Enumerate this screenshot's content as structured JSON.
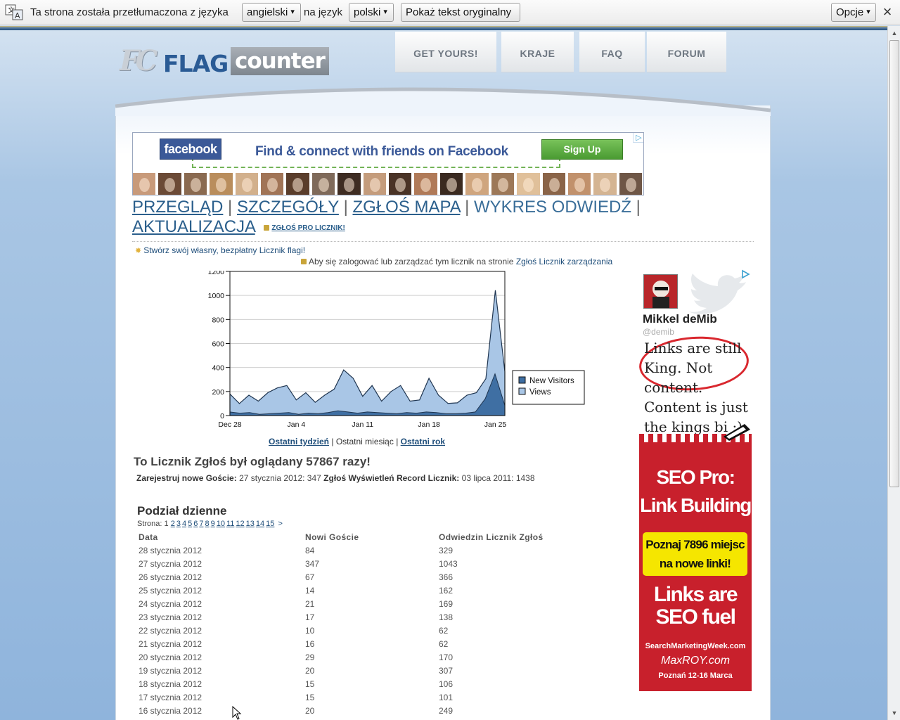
{
  "translate_bar": {
    "prefix": "Ta strona została przetłumaczona z języka",
    "from_lang": "angielski",
    "middle": "na język",
    "to_lang": "polski",
    "show_original": "Pokaż tekst oryginalny",
    "options": "Opcje"
  },
  "header": {
    "logo_flag": "FLAG",
    "logo_counter": "counter",
    "nav": [
      "GET YOURS!",
      "KRAJE",
      "FAQ",
      "FORUM"
    ]
  },
  "fb_ad": {
    "logo": "facebook",
    "tagline": "Find & connect with friends on Facebook",
    "signup": "Sign Up"
  },
  "subnav": {
    "items": [
      "PRZEGLĄD",
      "SZCZEGÓŁY",
      "ZGŁOŚ MAPA",
      "WYKRES ODWIEDŹ",
      "AKTUALIZACJA"
    ],
    "current": "WYKRES ODWIEDŹ",
    "pro": "ZGŁOŚ PRO LICZNIK!"
  },
  "create_link": "Stwórz swój własny, bezpłatny Licznik flagi!",
  "login_text": "Aby się zalogować lub zarządzać tym licznik na stronie",
  "login_link": "Zgłoś Licznik zarządzania",
  "chart_data": {
    "type": "area",
    "x_tick_labels": [
      "Dec 28",
      "Jan 4",
      "Jan 11",
      "Jan 18",
      "Jan 25"
    ],
    "y_tick_labels": [
      "0",
      "200",
      "400",
      "600",
      "800",
      "1000",
      "1200"
    ],
    "ylim": [
      0,
      1200
    ],
    "series": [
      {
        "name": "New Visitors",
        "color": "#3f6fa3",
        "values": [
          30,
          20,
          25,
          10,
          15,
          20,
          25,
          10,
          20,
          15,
          25,
          40,
          30,
          20,
          30,
          25,
          20,
          15,
          25,
          20,
          30,
          25,
          15,
          15,
          20,
          30,
          140,
          347,
          84
        ]
      },
      {
        "name": "Views",
        "color": "#a9c6e6",
        "values": [
          180,
          100,
          170,
          120,
          190,
          230,
          250,
          130,
          190,
          110,
          170,
          220,
          380,
          310,
          160,
          250,
          120,
          200,
          250,
          120,
          130,
          310,
          170,
          101,
          106,
          170,
          190,
          307,
          1043,
          366
        ]
      }
    ],
    "legend": "right"
  },
  "periods": {
    "week": "Ostatni tydzień",
    "month": "Ostatni miesiąc",
    "year": "Ostatni rok",
    "sep": "|"
  },
  "views_title": "To Licznik Zgłoś był oglądany 57867 razy!",
  "records": {
    "label1": "Zarejestruj nowe Goście:",
    "value1": "27 stycznia 2012: 347",
    "label2": "Zgłoś Wyświetleń Record Licznik:",
    "value2": "03 lipca 2011: 1438"
  },
  "daily": {
    "title": "Podział dzienne",
    "page_label": "Strona:",
    "current_page": "1",
    "pages": [
      "2",
      "3",
      "4",
      "5",
      "6",
      "7",
      "8",
      "9",
      "10",
      "11",
      "12",
      "13",
      "14",
      "15"
    ],
    "next": ">",
    "columns": [
      "Data",
      "Nowi Goście",
      "Odwiedzin Licznik Zgłoś"
    ],
    "rows": [
      [
        "28 stycznia 2012",
        "84",
        "329"
      ],
      [
        "27 stycznia 2012",
        "347",
        "1043"
      ],
      [
        "26 stycznia 2012",
        "67",
        "366"
      ],
      [
        "25 stycznia 2012",
        "14",
        "162"
      ],
      [
        "24 stycznia 2012",
        "21",
        "169"
      ],
      [
        "23 stycznia 2012",
        "17",
        "138"
      ],
      [
        "22 stycznia 2012",
        "10",
        "62"
      ],
      [
        "21 stycznia 2012",
        "16",
        "62"
      ],
      [
        "20 stycznia 2012",
        "29",
        "170"
      ],
      [
        "19 stycznia 2012",
        "20",
        "307"
      ],
      [
        "18 stycznia 2012",
        "15",
        "106"
      ],
      [
        "17 stycznia 2012",
        "15",
        "101"
      ],
      [
        "16 stycznia 2012",
        "20",
        "249"
      ]
    ]
  },
  "side_ad": {
    "name": "Mikkel deMib",
    "handle": "@demib",
    "quote": "Links are still King. Not content. Content is just the kings bi :)",
    "seo1": "SEO Pro:",
    "seo2": "Link Building",
    "yellow": "Poznaj 7896 miejsc na nowe linki!",
    "links1": "Links are",
    "links2": "SEO fuel",
    "site": "SearchMarketingWeek.com",
    "maxroy": "MaxROY.com",
    "event": "Poznań 12-16 Marca"
  }
}
